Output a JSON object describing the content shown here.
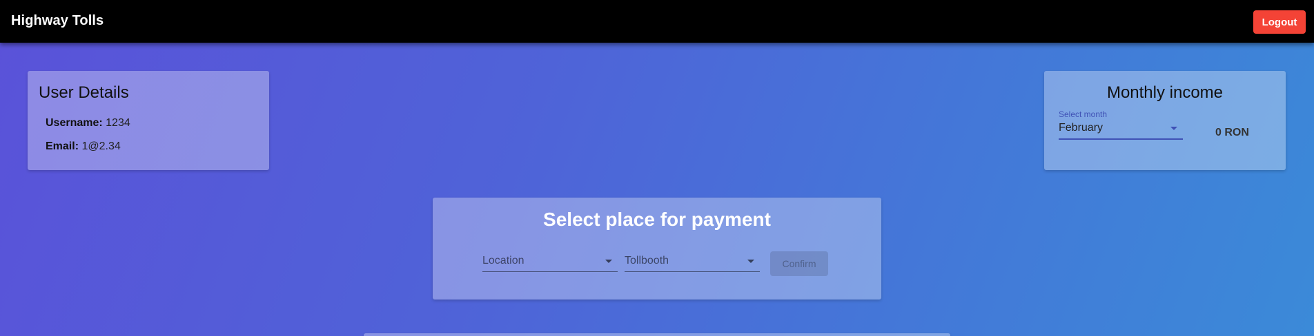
{
  "header": {
    "title": "Highway Tolls",
    "logout_label": "Logout",
    "logout_color": "#f44336"
  },
  "user_details": {
    "title": "User Details",
    "username_label": "Username:",
    "username_value": "1234",
    "email_label": "Email:",
    "email_value": "1@2.34"
  },
  "monthly_income": {
    "title": "Monthly income",
    "select_label": "Select month",
    "selected_month": "February",
    "amount": "0 RON",
    "accent_color": "#3f51b5"
  },
  "payment": {
    "title": "Select place for payment",
    "location_placeholder": "Location",
    "tollbooth_placeholder": "Tollbooth",
    "confirm_label": "Confirm"
  }
}
